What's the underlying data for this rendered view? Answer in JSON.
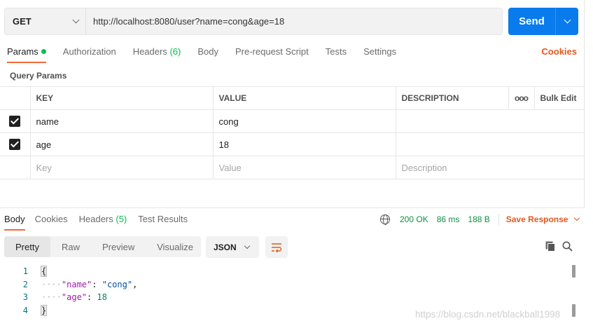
{
  "request": {
    "method": "GET",
    "url": "http://localhost:8080/user?name=cong&age=18",
    "send_label": "Send"
  },
  "request_tabs": [
    {
      "label": "Params",
      "active": true
    },
    {
      "label": "Authorization"
    },
    {
      "label": "Headers",
      "count": "(6)"
    },
    {
      "label": "Body"
    },
    {
      "label": "Pre-request Script"
    },
    {
      "label": "Tests"
    },
    {
      "label": "Settings"
    }
  ],
  "cookies_label": "Cookies",
  "query_params": {
    "title": "Query Params",
    "headers": {
      "key": "KEY",
      "value": "VALUE",
      "description": "DESCRIPTION",
      "more": "ooo",
      "bulk_edit": "Bulk Edit"
    },
    "rows": [
      {
        "checked": true,
        "key": "name",
        "value": "cong",
        "description": ""
      },
      {
        "checked": true,
        "key": "age",
        "value": "18",
        "description": ""
      }
    ],
    "placeholders": {
      "key": "Key",
      "value": "Value",
      "description": "Description"
    }
  },
  "response_tabs": [
    {
      "label": "Body",
      "active": true
    },
    {
      "label": "Cookies"
    },
    {
      "label": "Headers",
      "count": "(5)"
    },
    {
      "label": "Test Results"
    }
  ],
  "response_meta": {
    "status": "200 OK",
    "time": "86 ms",
    "size": "188 B",
    "save_label": "Save Response"
  },
  "view_modes": [
    {
      "label": "Pretty",
      "active": true
    },
    {
      "label": "Raw"
    },
    {
      "label": "Preview"
    },
    {
      "label": "Visualize"
    }
  ],
  "format": "JSON",
  "body_lines": [
    {
      "n": "1",
      "text": "{"
    },
    {
      "n": "2",
      "key": "\"name\"",
      "value": "\"cong\"",
      "comma": ","
    },
    {
      "n": "3",
      "key": "\"age\"",
      "value": "18",
      "comma": ""
    },
    {
      "n": "4",
      "text": "}"
    }
  ],
  "watermark": "https://blog.csdn.net/blackball1998",
  "colors": {
    "accent": "#f26b3a",
    "send": "#097bed",
    "link": "#e0591f",
    "status_ok": "#0c8f43",
    "count_green": "#0cbb52"
  }
}
